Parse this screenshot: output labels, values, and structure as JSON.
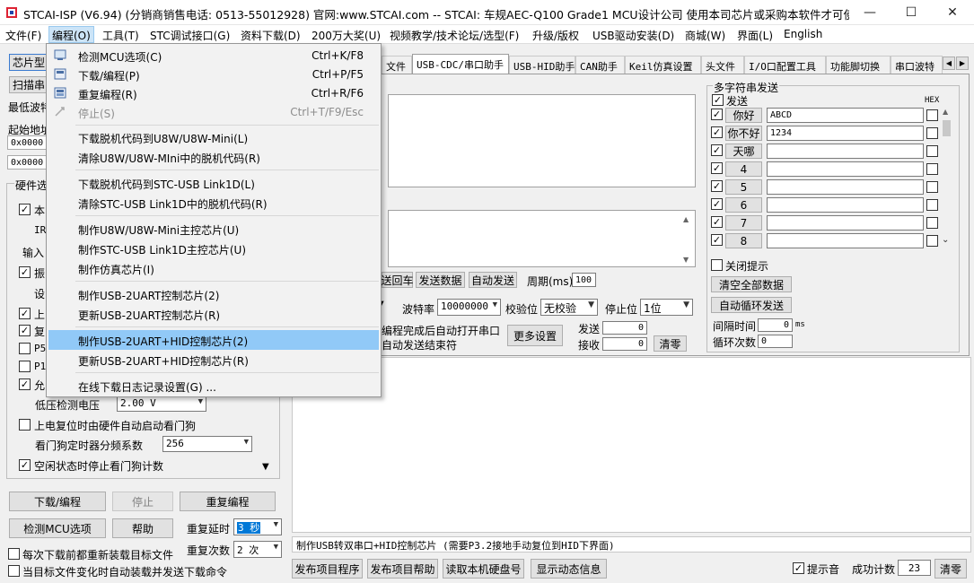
{
  "window": {
    "title": "STCAI-ISP (V6.94) (分销商销售电话: 0513-55012928) 官网:www.STCAI.com  -- STCAI: 车规AEC-Q100 Grade1 MCU设计公司 使用本司芯片或采购本软件才可使用本...",
    "minimize": "—",
    "maximize": "☐",
    "close": "✕"
  },
  "menubar": [
    "文件(F)",
    "编程(O)",
    "工具(T)",
    "STC调试接口(G)",
    "资料下载(D)",
    "200万大奖(U)",
    "视频教学/技术论坛/选型(F)",
    "升级/版权",
    "USB驱动安装(D)",
    "商城(W)",
    "界面(L)",
    "English"
  ],
  "dropdown": {
    "items": [
      {
        "label": "检测MCU选项(C)",
        "shortcut": "Ctrl+K/F8",
        "icon": "detect-icon"
      },
      {
        "label": "下载/编程(P)",
        "shortcut": "Ctrl+P/F5",
        "icon": "program-icon"
      },
      {
        "label": "重复编程(R)",
        "shortcut": "Ctrl+R/F6",
        "icon": "repeat-icon"
      },
      {
        "label": "停止(S)",
        "shortcut": "Ctrl+T/F9/Esc",
        "icon": "stop-icon",
        "disabled": true
      },
      {
        "label": "下载脱机代码到U8W/U8W-Mini(L)"
      },
      {
        "label": "清除U8W/U8W-MIni中的脱机代码(R)"
      },
      {
        "label": "下载脱机代码到STC-USB Link1D(L)"
      },
      {
        "label": "清除STC-USB Link1D中的脱机代码(R)"
      },
      {
        "label": "制作U8W/U8W-Mini主控芯片(U)"
      },
      {
        "label": "制作STC-USB Link1D主控芯片(U)"
      },
      {
        "label": "制作仿真芯片(I)"
      },
      {
        "label": "制作USB-2UART控制芯片(2)"
      },
      {
        "label": "更新USB-2UART控制芯片(R)"
      },
      {
        "label": "制作USB-2UART+HID控制芯片(2)",
        "highlighted": true
      },
      {
        "label": "更新USB-2UART+HID控制芯片(R)"
      },
      {
        "label": "在线下载日志记录设置(G) ..."
      }
    ]
  },
  "left": {
    "chip_model_btn": "芯片型",
    "scan_btn": "扫描串",
    "min_baud_label": "最低波特",
    "start_addr_label": "起始地址",
    "addr1": "0x0000",
    "addr2": "0x0000",
    "hw_options_title": "硬件选",
    "opt_rows": [
      {
        "label": "本",
        "checked": true
      },
      {
        "label": "IR",
        "checked": null
      },
      {
        "label": "输入",
        "checked": null
      },
      {
        "label": "振",
        "checked": true
      },
      {
        "label": "设",
        "checked": null
      },
      {
        "label": "上",
        "checked": true
      },
      {
        "label": "复",
        "checked": true
      },
      {
        "label": "P5",
        "checked": false
      },
      {
        "label": "P1",
        "checked": false
      },
      {
        "label": "允",
        "checked": true
      }
    ],
    "lvd_label": "低压检测电压",
    "lvd_value": "2.00 V",
    "power_on_wdt_label": "上电复位时由硬件自动启动看门狗",
    "wdt_prescale_label": "看门狗定时器分频系数",
    "wdt_prescale_value": "256",
    "idle_wdt_label": "空闲状态时停止看门狗计数",
    "download_btn": "下载/编程",
    "stop_btn": "停止",
    "repeat_btn": "重复编程",
    "detect_btn": "检测MCU选项",
    "help_btn": "帮助",
    "repeat_delay_label": "重复延时",
    "repeat_delay_value": "3 秒",
    "repeat_count_label": "重复次数",
    "repeat_count_value": "2 次",
    "reload_label": "每次下载前都重新装载目标文件",
    "auto_send_label": "当目标文件变化时自动装载并发送下载命令"
  },
  "tabs": [
    "文件",
    "USB-CDC/串口助手",
    "USB-HID助手",
    "CAN助手",
    "Keil仿真设置",
    "头文件",
    "I/O口配置工具",
    "功能脚切换",
    "串口波特"
  ],
  "serial": {
    "send_return_btn": "送回车",
    "send_data_btn": "发送数据",
    "auto_send_btn": "自动发送",
    "period_label": "周期(ms)",
    "period_value": "100",
    "baud_label": "波特率",
    "baud_value": "10000000",
    "parity_label": "校验位",
    "parity_value": "无校验",
    "stop_label": "停止位",
    "stop_value": "1位",
    "open_after_label": "编程完成后自动打开串口",
    "auto_send_end_label": "自动发送结束符",
    "more_settings_btn": "更多设置",
    "send_count_label": "发送",
    "send_count_value": "0",
    "recv_count_label": "接收",
    "recv_count_value": "0",
    "clear_btn": "清零"
  },
  "multi": {
    "title": "多字符串发送",
    "send_label": "发送",
    "hex_label": "HEX",
    "rows": [
      {
        "name": "你好",
        "value": "ABCD"
      },
      {
        "name": "你不好",
        "value": "1234"
      },
      {
        "name": "天哪",
        "value": ""
      },
      {
        "name": "4",
        "value": ""
      },
      {
        "name": "5",
        "value": ""
      },
      {
        "name": "6",
        "value": ""
      },
      {
        "name": "7",
        "value": ""
      },
      {
        "name": "8",
        "value": ""
      }
    ],
    "close_hint_label": "关闭提示",
    "clear_all_btn": "清空全部数据",
    "auto_loop_btn": "自动循环发送",
    "interval_label": "间隔时间",
    "interval_value": "0",
    "interval_unit": "ms",
    "loop_count_label": "循环次数",
    "loop_count_value": "0"
  },
  "status_text": "制作USB转双串口+HID控制芯片 (需要P3.2接地手动复位到HID下界面)",
  "bottom": {
    "publish_prog_btn": "发布项目程序",
    "publish_help_btn": "发布项目帮助",
    "read_disk_btn": "读取本机硬盘号",
    "show_anim_btn": "显示动态信息",
    "beep_label": "提示音",
    "success_label": "成功计数",
    "success_value": "23",
    "clear_btn": "清零"
  }
}
